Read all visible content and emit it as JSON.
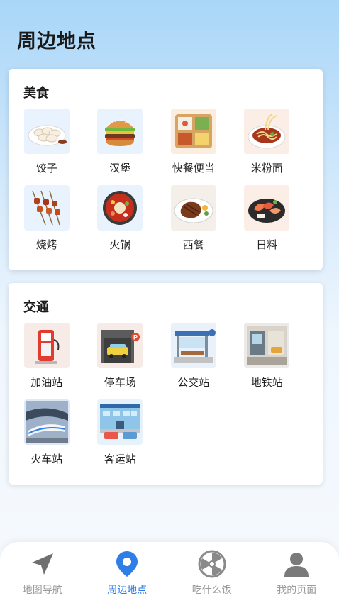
{
  "page": {
    "title": "周边地点"
  },
  "food": {
    "title": "美食",
    "items": [
      {
        "label": "饺子",
        "icon": "dumplings-icon"
      },
      {
        "label": "汉堡",
        "icon": "burger-icon"
      },
      {
        "label": "快餐便当",
        "icon": "bento-icon"
      },
      {
        "label": "米粉面",
        "icon": "noodles-icon"
      },
      {
        "label": "烧烤",
        "icon": "bbq-icon"
      },
      {
        "label": "火锅",
        "icon": "hotpot-icon"
      },
      {
        "label": "西餐",
        "icon": "steak-icon"
      },
      {
        "label": "日料",
        "icon": "sashimi-icon"
      }
    ]
  },
  "transport": {
    "title": "交通",
    "items": [
      {
        "label": "加油站",
        "icon": "gas-station-icon"
      },
      {
        "label": "停车场",
        "icon": "parking-icon"
      },
      {
        "label": "公交站",
        "icon": "bus-stop-icon"
      },
      {
        "label": "地铁站",
        "icon": "subway-icon"
      },
      {
        "label": "火车站",
        "icon": "train-station-icon"
      },
      {
        "label": "客运站",
        "icon": "coach-station-icon"
      }
    ]
  },
  "tabbar": {
    "active_color": "#2f7ee6",
    "inactive_color": "#9a9a9a",
    "tabs": [
      {
        "label": "地图导航",
        "icon": "navigation-arrow-icon",
        "active": false
      },
      {
        "label": "周边地点",
        "icon": "location-pin-icon",
        "active": true
      },
      {
        "label": "吃什么饭",
        "icon": "wheel-icon",
        "active": false
      },
      {
        "label": "我的页面",
        "icon": "user-icon",
        "active": false
      }
    ]
  }
}
